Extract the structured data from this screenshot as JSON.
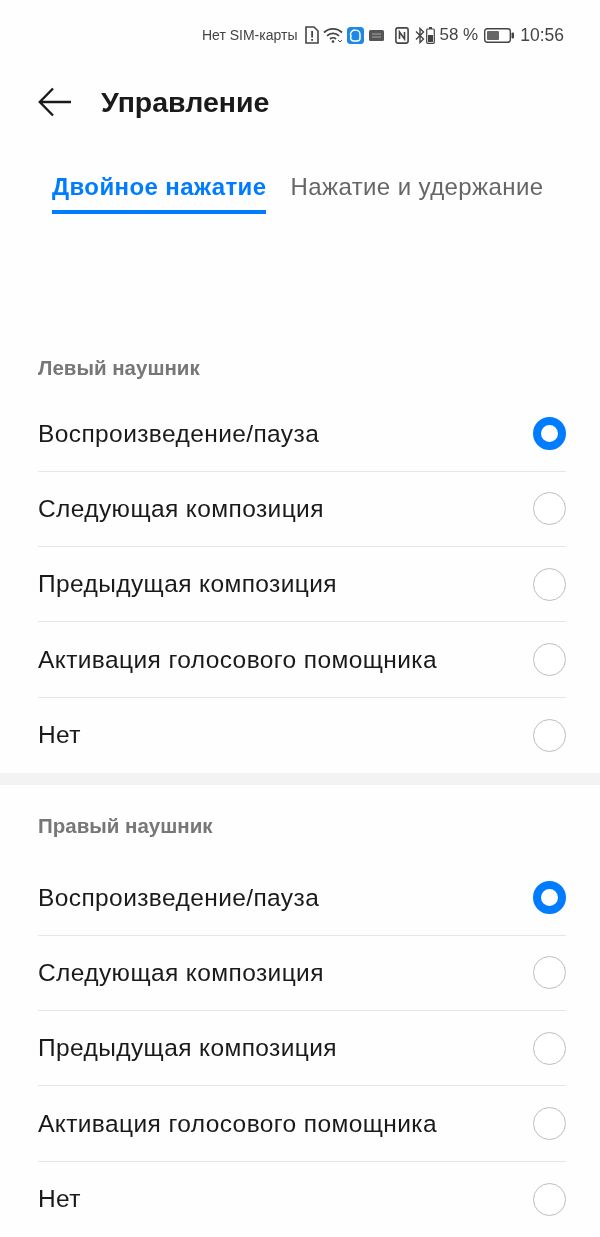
{
  "status_bar": {
    "carrier": "Нет SIM-карты",
    "battery_percent": "58 %",
    "time": "10:56"
  },
  "header": {
    "title": "Управление"
  },
  "tabs": [
    {
      "label": "Двойное нажатие",
      "selected": true
    },
    {
      "label": "Нажатие и удержание",
      "selected": false
    }
  ],
  "sections": [
    {
      "title": "Левый наушник",
      "options": [
        {
          "label": "Воспроизведение/пауза",
          "selected": true
        },
        {
          "label": "Следующая композиция",
          "selected": false
        },
        {
          "label": "Предыдущая композиция",
          "selected": false
        },
        {
          "label": "Активация голосового помощника",
          "selected": false
        },
        {
          "label": "Нет",
          "selected": false
        }
      ]
    },
    {
      "title": "Правый наушник",
      "options": [
        {
          "label": "Воспроизведение/пауза",
          "selected": true
        },
        {
          "label": "Следующая композиция",
          "selected": false
        },
        {
          "label": "Предыдущая композиция",
          "selected": false
        },
        {
          "label": "Активация голосового помощника",
          "selected": false
        },
        {
          "label": "Нет",
          "selected": false
        }
      ]
    }
  ]
}
